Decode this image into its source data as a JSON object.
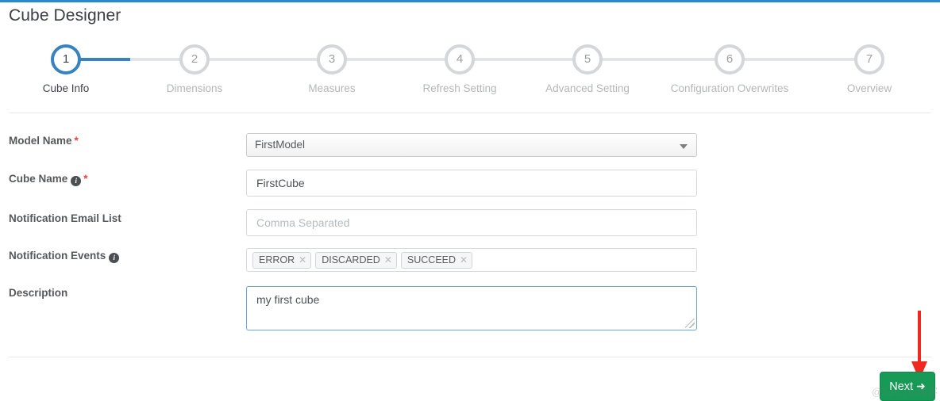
{
  "header": {
    "title": "Cube Designer",
    "accent_color": "#2a89c8"
  },
  "stepper": {
    "active_index": 1,
    "active_color": "#3783c1",
    "inactive_color": "#d3d7da",
    "steps": [
      {
        "number": "1",
        "label": "Cube Info"
      },
      {
        "number": "2",
        "label": "Dimensions"
      },
      {
        "number": "3",
        "label": "Measures"
      },
      {
        "number": "4",
        "label": "Refresh Setting"
      },
      {
        "number": "5",
        "label": "Advanced Setting"
      },
      {
        "number": "6",
        "label": "Configuration Overwrites"
      },
      {
        "number": "7",
        "label": "Overview"
      }
    ]
  },
  "form": {
    "model_name": {
      "label": "Model Name",
      "required_mark": "*",
      "value": "FirstModel",
      "caret_icon": "chevron-down-icon"
    },
    "cube_name": {
      "label": "Cube Name",
      "info_icon": "info-icon",
      "info_glyph": "i",
      "required_mark": "*",
      "value": "FirstCube"
    },
    "notification_email": {
      "label": "Notification Email List",
      "value": "",
      "placeholder": "Comma Separated"
    },
    "notification_events": {
      "label": "Notification Events",
      "info_icon": "info-icon",
      "info_glyph": "i",
      "tags": [
        {
          "text": "ERROR",
          "remove_glyph": "✕"
        },
        {
          "text": "DISCARDED",
          "remove_glyph": "✕"
        },
        {
          "text": "SUCCEED",
          "remove_glyph": "✕"
        }
      ]
    },
    "description": {
      "label": "Description",
      "value": "my first cube",
      "focused_border_color": "#6ba6d6"
    }
  },
  "footer": {
    "next_label": "Next",
    "next_arrow_glyph": "➜",
    "next_color": "#169a56",
    "annotation_arrow_color": "#f0281e",
    "watermark": "@51CTO博客"
  }
}
